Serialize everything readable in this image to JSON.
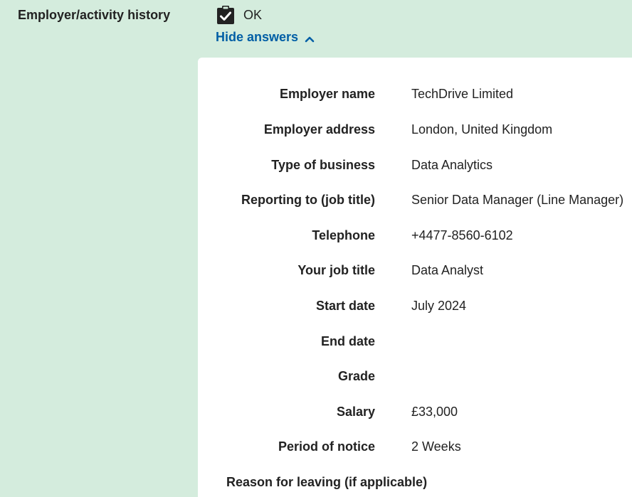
{
  "section": {
    "title": "Employer/activity history",
    "status": "OK",
    "status_icon": "clipboard-check-icon",
    "toggle_label": "Hide answers",
    "toggle_icon": "chevron-up-icon",
    "link_color": "#005ea5",
    "background_color": "#d4ecdd"
  },
  "answers": [
    {
      "label": "Employer name",
      "value": "TechDrive Limited"
    },
    {
      "label": "Employer address",
      "value": "London, United Kingdom"
    },
    {
      "label": "Type of business",
      "value": "Data Analytics"
    },
    {
      "label": "Reporting to (job title)",
      "value": "Senior Data Manager (Line Manager)"
    },
    {
      "label": "Telephone",
      "value": "+4477-8560-6102"
    },
    {
      "label": "Your job title",
      "value": "Data Analyst"
    },
    {
      "label": "Start date",
      "value": "July 2024"
    },
    {
      "label": "End date",
      "value": ""
    },
    {
      "label": "Grade",
      "value": ""
    },
    {
      "label": "Salary",
      "value": "£33,000"
    },
    {
      "label": "Period of notice",
      "value": "2 Weeks"
    }
  ],
  "last_question": "Reason for leaving (if applicable)"
}
